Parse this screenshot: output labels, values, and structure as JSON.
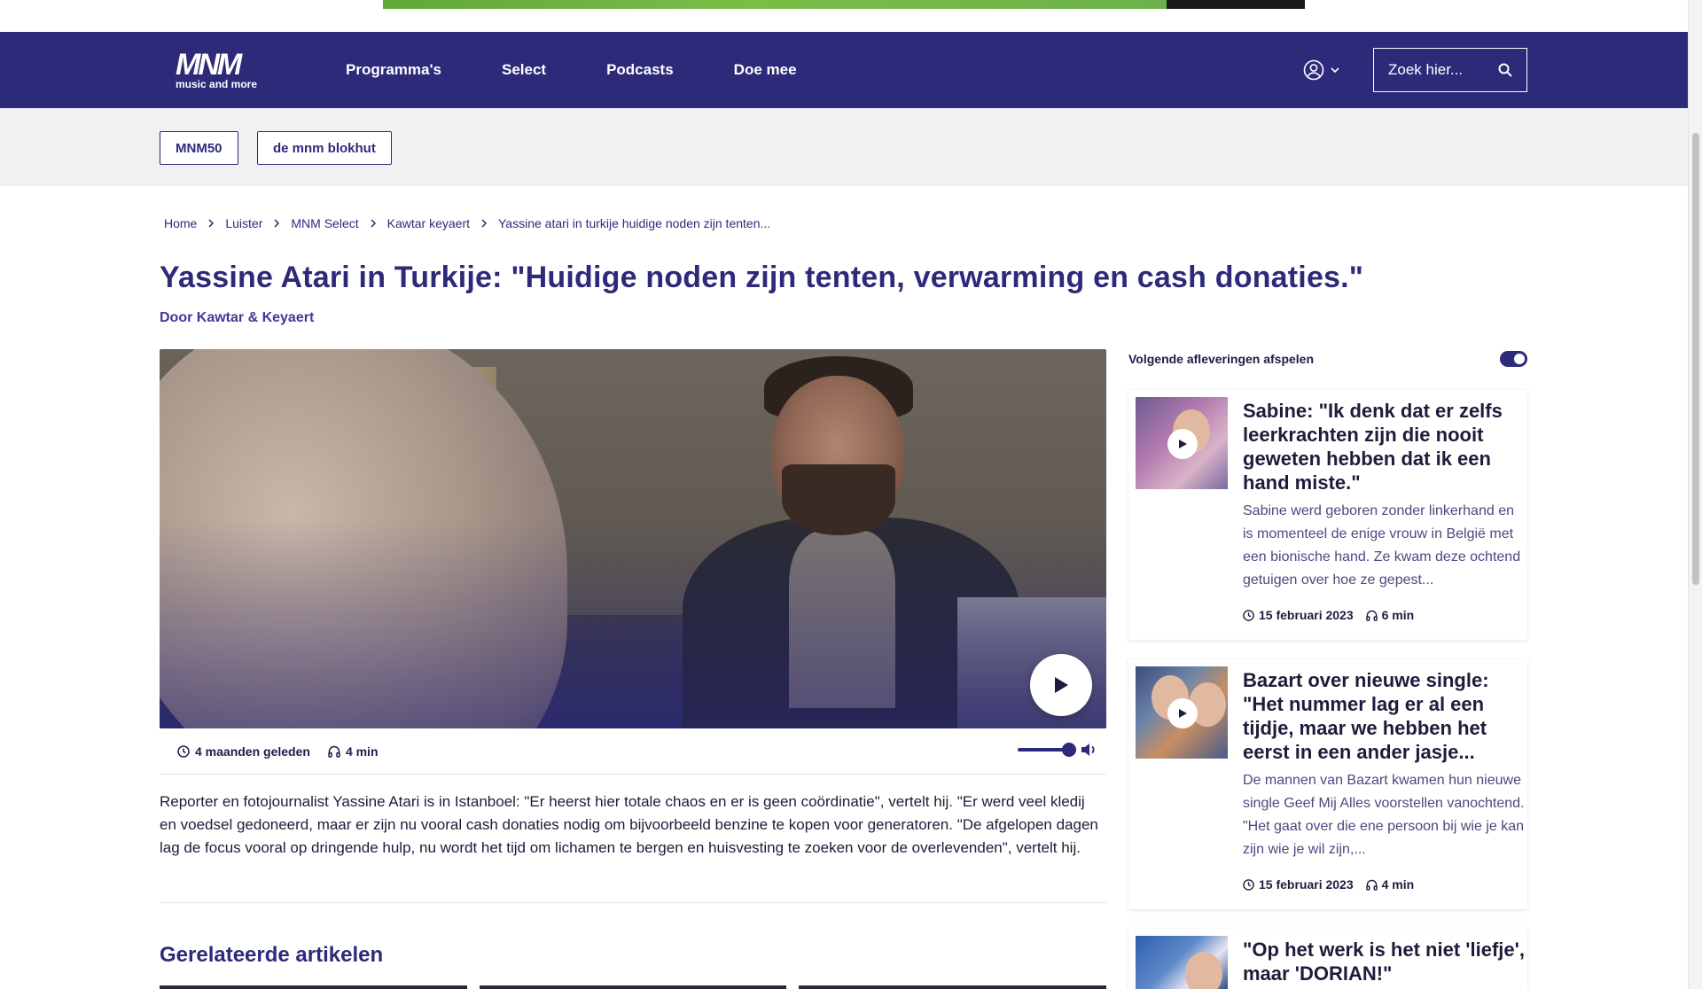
{
  "header": {
    "logo_mark": "MNM",
    "logo_sub": "music and more",
    "nav": [
      "Programma's",
      "Select",
      "Podcasts",
      "Doe mee"
    ],
    "search_placeholder": "Zoek hier..."
  },
  "tags": [
    "MNM50",
    "de mnm blokhut"
  ],
  "breadcrumb": [
    "Home",
    "Luister",
    "MNM Select",
    "Kawtar keyaert",
    "Yassine atari in turkije huidige noden zijn tenten..."
  ],
  "article": {
    "title": "Yassine Atari in Turkije: \"Huidige noden zijn tenten, verwarming en cash donaties.\"",
    "byline": "Door Kawtar & Keyaert",
    "published": "4 maanden geleden",
    "duration": "4 min",
    "volume": 1.0,
    "body": "Reporter en fotojournalist Yassine Atari is in Istanboel: \"Er heerst hier totale chaos en er is geen coördinatie\", vertelt hij. \"Er werd veel kledij en voedsel gedoneerd, maar er zijn nu vooral cash donaties nodig om bijvoorbeeld benzine te kopen voor generatoren. \"De afgelopen dagen lag de focus vooral op dringende hulp, nu wordt het tijd om lichamen te bergen en huisvesting te zoeken voor de overlevenden\", vertelt hij."
  },
  "related_heading": "Gerelateerde artikelen",
  "sidebar": {
    "autoplay_label": "Volgende afleveringen afspelen",
    "autoplay_on": true,
    "episodes": [
      {
        "title": "Sabine: \"Ik denk dat er zelfs leerkrachten zijn die nooit geweten hebben dat ik een hand miste.\"",
        "description": "Sabine werd geboren zonder linkerhand en is momenteel de enige vrouw in België met een bionische hand. Ze kwam deze ochtend getuigen over hoe ze gepest...",
        "date": "15 februari 2023",
        "duration": "6 min"
      },
      {
        "title": "Bazart over nieuwe single: \"Het nummer lag er al een tijdje, maar we hebben het eerst in een ander jasje...",
        "description": "De mannen van Bazart kwamen hun nieuwe single Geef Mij Alles voorstellen vanochtend. \"Het gaat over die ene persoon bij wie je kan zijn wie je wil zijn,...",
        "date": "15 februari 2023",
        "duration": "4 min"
      },
      {
        "title": "\"Op het werk is het niet 'liefje', maar 'DORIAN!\""
      }
    ]
  },
  "colors": {
    "brand": "#2d2a7a",
    "page_bg": "#ffffff",
    "tagbar_bg": "#f1f1f4"
  }
}
